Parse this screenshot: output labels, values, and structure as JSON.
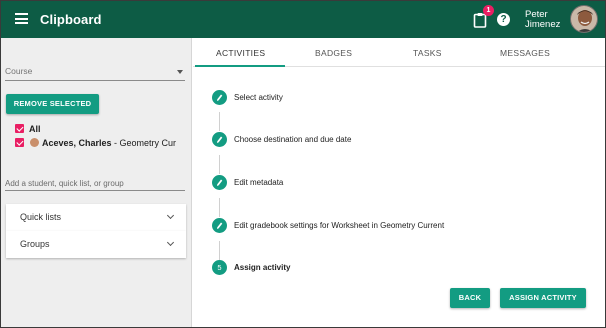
{
  "app": {
    "title": "Clipboard",
    "notification_count": "1",
    "user": {
      "first_name": "Peter",
      "last_name": "Jimenez"
    }
  },
  "sidebar": {
    "course_placeholder": "Course",
    "remove_selected_label": "REMOVE SELECTED",
    "all_label": "All",
    "student": {
      "name": "Aceves, Charles",
      "suffix": " - Geometry Cur"
    },
    "add_student_placeholder": "Add a student, quick list, or group",
    "sections": [
      {
        "label": "Quick lists"
      },
      {
        "label": "Groups"
      }
    ]
  },
  "tabs": [
    {
      "label": "ACTIVITIES",
      "active": true
    },
    {
      "label": "BADGES"
    },
    {
      "label": "TASKS"
    },
    {
      "label": "MESSAGES"
    }
  ],
  "steps": [
    {
      "label": "Select activity",
      "state": "done",
      "icon": "pencil-icon"
    },
    {
      "label": "Choose destination and due date",
      "state": "done",
      "icon": "pencil-icon"
    },
    {
      "label": "Edit metadata",
      "state": "done",
      "icon": "pencil-icon"
    },
    {
      "label": "Edit gradebook settings for Worksheet in Geometry Current",
      "state": "done",
      "icon": "pencil-icon"
    },
    {
      "label": "Assign activity",
      "state": "current",
      "number": "5"
    }
  ],
  "actions": {
    "back_label": "BACK",
    "assign_label": "ASSIGN ACTIVITY"
  },
  "colors": {
    "appbar": "#0d5c45",
    "accent": "#139c82",
    "checkbox": "#e91e63"
  }
}
